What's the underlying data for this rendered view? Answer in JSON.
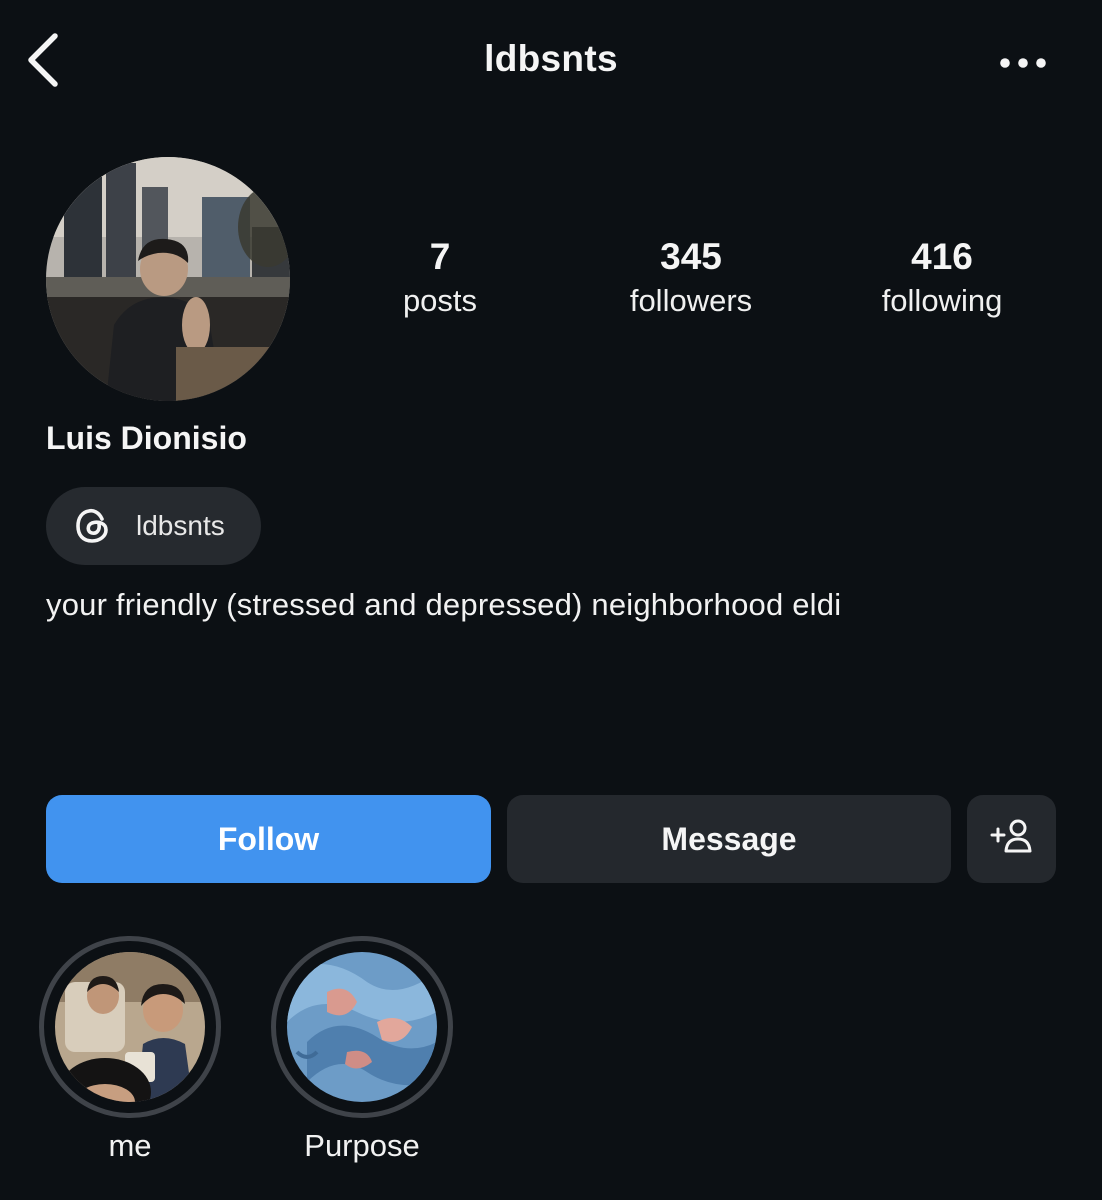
{
  "header": {
    "back_icon": "chevron-left-icon",
    "username": "ldbsnts",
    "more_icon": "more-horizontal-icon"
  },
  "profile": {
    "avatar": "profile-photo",
    "full_name": "Luis Dionisio",
    "threads_icon": "threads-icon",
    "threads_handle": "ldbsnts",
    "bio": "your friendly (stressed and depressed) neighborhood eldi"
  },
  "stats": [
    {
      "value": "7",
      "label": "posts"
    },
    {
      "value": "345",
      "label": "followers"
    },
    {
      "value": "416",
      "label": "following"
    }
  ],
  "actions": {
    "follow_label": "Follow",
    "message_label": "Message",
    "suggest_icon": "add-person-icon"
  },
  "highlights": [
    {
      "label": "me"
    },
    {
      "label": "Purpose"
    }
  ],
  "colors": {
    "background": "#0c1014",
    "follow_button": "#4193ef",
    "secondary_button": "#24282d",
    "text": "#f5f5f5"
  }
}
